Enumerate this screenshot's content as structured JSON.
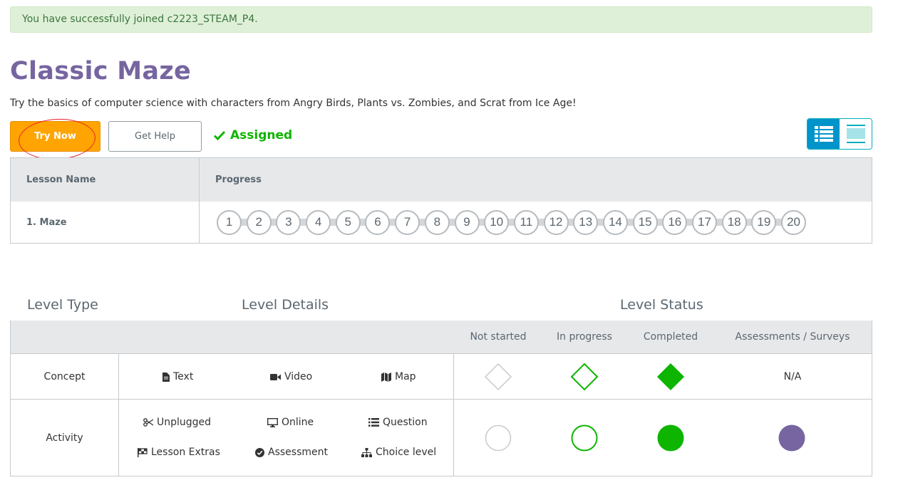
{
  "alert": {
    "text": "You have successfully joined c2223_STEAM_P4."
  },
  "course": {
    "title": "Classic Maze",
    "description": "Try the basics of computer science with characters from Angry Birds, Plants vs. Zombies, and Scrat from Ice Age!"
  },
  "actions": {
    "try_now": "Try Now",
    "get_help": "Get Help",
    "assigned": "Assigned"
  },
  "progress_table": {
    "headers": {
      "lesson_name": "Lesson Name",
      "progress": "Progress"
    },
    "lesson": {
      "name": "1. Maze",
      "levels": [
        "1",
        "2",
        "3",
        "4",
        "5",
        "6",
        "7",
        "8",
        "9",
        "10",
        "11",
        "12",
        "13",
        "14",
        "15",
        "16",
        "17",
        "18",
        "19",
        "20"
      ]
    }
  },
  "key": {
    "headings": {
      "level_type": "Level Type",
      "level_details": "Level Details",
      "level_status": "Level Status"
    },
    "status_columns": {
      "not_started": "Not started",
      "in_progress": "In progress",
      "completed": "Completed",
      "assessments": "Assessments / Surveys"
    },
    "concept": {
      "label": "Concept",
      "text": "Text",
      "video": "Video",
      "map": "Map",
      "na": "N/A"
    },
    "activity": {
      "label": "Activity",
      "unplugged": "Unplugged",
      "online": "Online",
      "question": "Question",
      "lesson_extras": "Lesson Extras",
      "assessment": "Assessment",
      "choice_level": "Choice level"
    }
  },
  "colors": {
    "purple": "#7665a0",
    "orange": "#ffa400",
    "green": "#0eb500",
    "teal": "#0094ca"
  }
}
